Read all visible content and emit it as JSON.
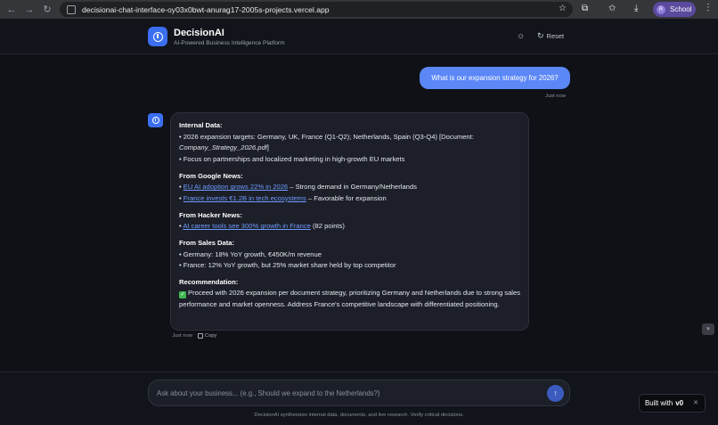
{
  "browser": {
    "url": "decisionai-chat-interface-oy03x0bwt-anurag17-2005s-projects.vercel.app",
    "profile_initial": "R",
    "profile_name": "School"
  },
  "header": {
    "title": "DecisionAI",
    "subtitle": "AI-Powered Business Intelligence Platform",
    "reset_label": "Reset"
  },
  "conversation": {
    "user_message": "What is our expansion strategy for 2026?",
    "user_time": "Just now",
    "bot_time": "Just now",
    "copy_label": "Copy",
    "response": {
      "internal": {
        "title": "Internal Data:",
        "line1_text": "• 2026 expansion targets: Germany, UK, France (Q1-Q2); Netherlands, Spain (Q3-Q4) [Document: ",
        "line1_doc": "Company_Strategy_2026.pdf",
        "line1_end": "]",
        "line2": "• Focus on partnerships and localized marketing in high-growth EU markets"
      },
      "google": {
        "title": "From Google News:",
        "item1_link": "EU AI adoption grows 22% in 2026",
        "item1_text": " – Strong demand in Germany/Netherlands",
        "item2_link": "France invests €1.2B in tech ecosystems",
        "item2_text": " – Favorable for expansion"
      },
      "hacker": {
        "title": "From Hacker News:",
        "item1_link": "AI career tools see 300% growth in France",
        "item1_text": " (82 points)"
      },
      "sales": {
        "title": "From Sales Data:",
        "line1": "• Germany: 18% YoY growth, €450K/m revenue",
        "line2": "• France: 12% YoY growth, but 25% market share held by top competitor"
      },
      "recommendation": {
        "title": "Recommendation:",
        "text": "Proceed with 2026 expansion per document strategy, prioritizing Germany and Netherlands due to strong sales performance and market openness. Address France's competitive landscape with differentiated positioning."
      }
    }
  },
  "input": {
    "placeholder": "Ask about your business... (e.g., Should we expand to the Netherlands?)"
  },
  "footer": {
    "disclaimer": "DecisionAI synthesizes internal data, documents, and live research. Verify critical decisions."
  },
  "badge": {
    "label": "Built with",
    "brand": "v0"
  },
  "colors": {
    "accent": "#3b6ff0",
    "user_bubble": "#5b87f7",
    "link": "#6f9bff",
    "background": "#0f1117"
  }
}
